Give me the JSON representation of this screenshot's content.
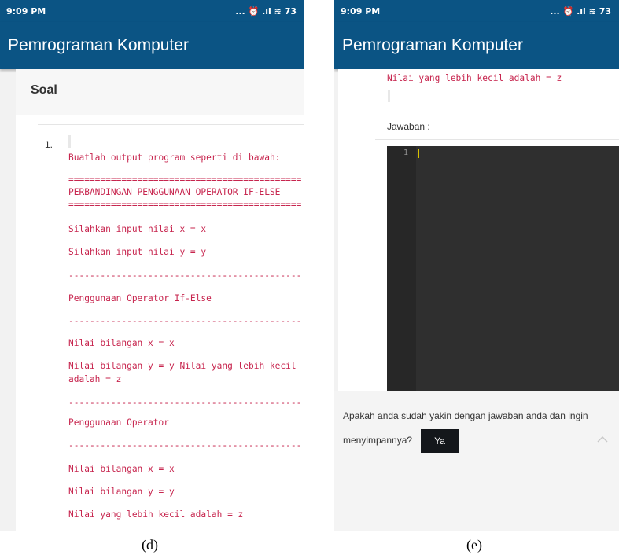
{
  "phone_d": {
    "status_time": "9:09 PM",
    "status_icons": "... ⏰ .ıl ≋ 73",
    "app_title": "Pemrograman Komputer",
    "section_title": "Soal",
    "question_number": "1.",
    "lines": [
      "Buatlah output program seperti di bawah:",
      "============================================",
      "PERBANDINGAN PENGGUNAAN OPERATOR IF-ELSE",
      "============================================",
      "Silahkan input nilai x = x",
      "Silahkan input nilai y = y",
      "--------------------------------------------",
      "Penggunaan Operator If-Else",
      "--------------------------------------------",
      "Nilai bilangan x = x",
      "Nilai bilangan y = y Nilai yang lebih kecil",
      "adalah = z",
      "--------------------------------------------",
      "Penggunaan Operator",
      "--------------------------------------------",
      "Nilai bilangan x = x",
      "Nilai bilangan y = y",
      "Nilai yang lebih kecil adalah = z"
    ],
    "caption": "(d)"
  },
  "phone_e": {
    "status_time": "9:09 PM",
    "status_icons": "... ⏰ .ıl ≋ 73",
    "app_title": "Pemrograman Komputer",
    "code_top_line": "Nilai yang lebih kecil adalah = z",
    "answer_label": "Jawaban :",
    "editor_line_number": "1",
    "confirm_line1": "Apakah anda sudah yakin dengan jawaban anda dan ingin",
    "confirm_line2": "menyimpannya?",
    "yes_button": "Ya",
    "scroll_top_icon": "chevron-up-icon",
    "caption": "(e)"
  },
  "colors": {
    "app_bar": "#0b5484",
    "code_text": "#c7254e",
    "editor_bg": "#2f2f2f",
    "button_bg": "#14171b"
  }
}
